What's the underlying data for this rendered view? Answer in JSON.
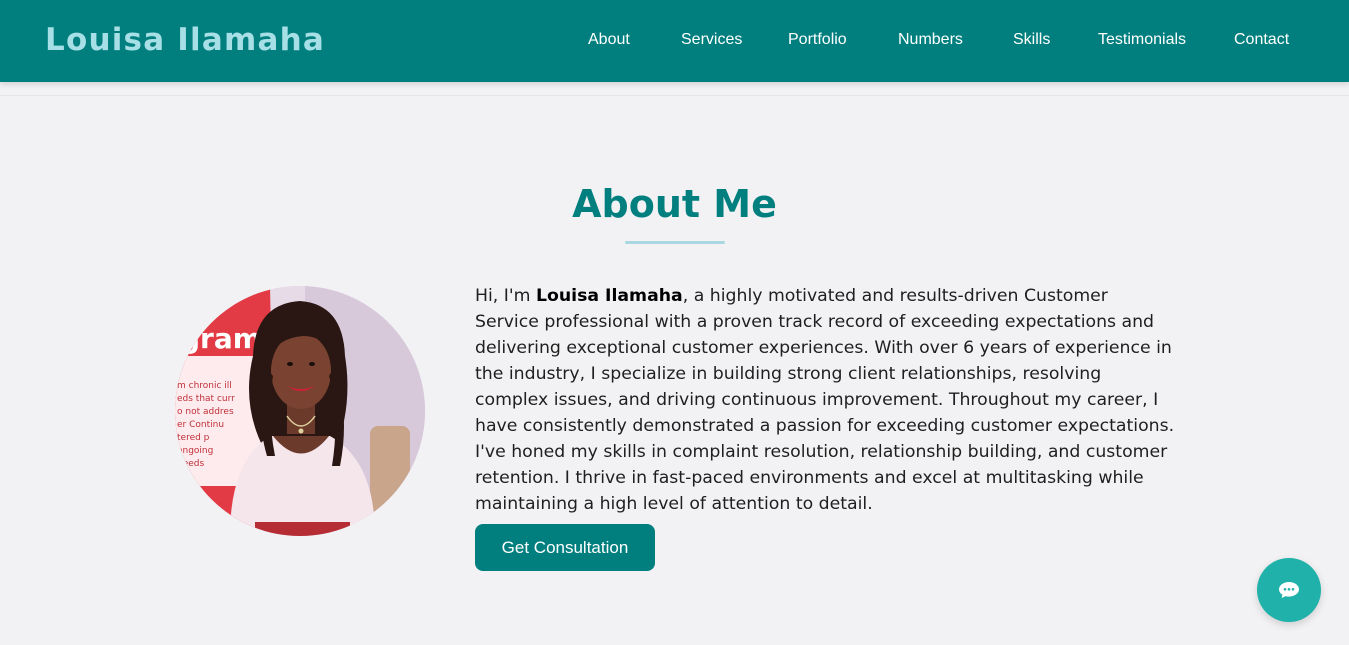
{
  "header": {
    "brand": "Louisa Ilamaha",
    "nav": [
      {
        "label": "About"
      },
      {
        "label": "Services"
      },
      {
        "label": "Portfolio"
      },
      {
        "label": "Numbers"
      },
      {
        "label": "Skills"
      },
      {
        "label": "Testimonials"
      },
      {
        "label": "Contact"
      }
    ]
  },
  "about": {
    "title": "About Me",
    "bio_prefix": "Hi, I'm ",
    "bio_name": "Louisa Ilamaha",
    "bio_rest": ", a highly motivated and results-driven Customer Service professional with a proven track record of exceeding expectations and delivering exceptional customer experiences. With over 6 years of experience in the industry, I specialize in building strong client relationships, resolving complex issues, and driving continuous improvement. Throughout my career, I have consistently demonstrated a passion for exceeding customer expectations. I've honed my skills in complaint resolution, relationship building, and customer retention. I thrive in fast-paced environments and excel at multitasking while maintaining a high level of attention to detail.",
    "cta_label": "Get Consultation",
    "photo_icon": "portrait-photo"
  },
  "chat": {
    "icon": "chat-bubble-icon"
  },
  "colors": {
    "primary": "#017f7f",
    "brand_text": "#a6dfe5",
    "underline": "#a9d8e2",
    "chat_button": "#20b2aa",
    "background": "#f2f2f4"
  }
}
